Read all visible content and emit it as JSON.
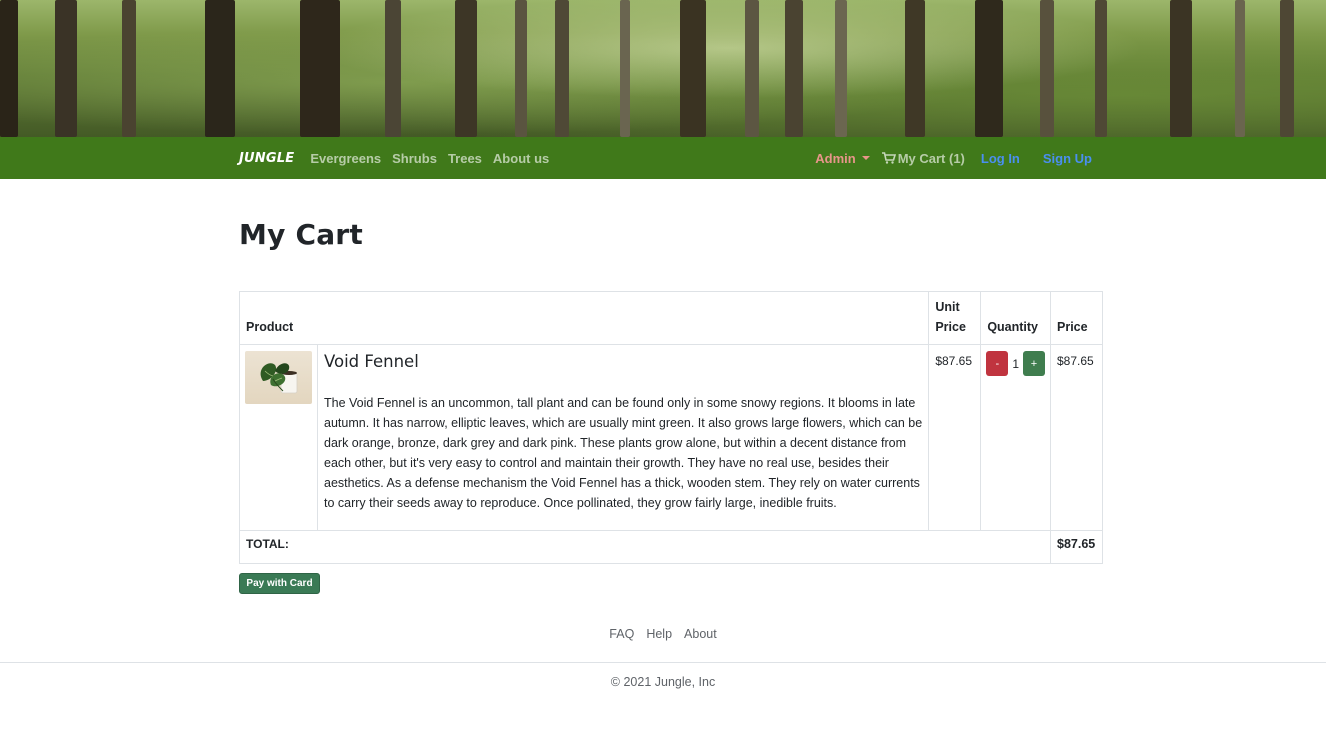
{
  "navbar": {
    "brand": "JUNGLE",
    "links": [
      "Evergreens",
      "Shrubs",
      "Trees",
      "About us"
    ],
    "admin_label": "Admin",
    "cart_label": "My Cart (1)",
    "login_label": "Log In",
    "signup_label": "Sign Up",
    "colors": {
      "bar": "#40791a",
      "admin": "#e8968a",
      "auth": "#4a8ff0"
    }
  },
  "page": {
    "title": "My Cart"
  },
  "cart": {
    "headers": {
      "product": "Product",
      "unit_price": "Unit Price",
      "quantity": "Quantity",
      "price": "Price"
    },
    "items": [
      {
        "name": "Void Fennel",
        "description": "The Void Fennel is an uncommon, tall plant and can be found only in some snowy regions. It blooms in late autumn. It has narrow, elliptic leaves, which are usually mint green. It also grows large flowers, which can be dark orange, bronze, dark grey and dark pink. These plants grow alone, but within a decent distance from each other, but it's very easy to control and maintain their growth. They have no real use, besides their aesthetics. As a defense mechanism the Void Fennel has a thick, wooden stem. They rely on water currents to carry their seeds away to reproduce. Once pollinated, they grow fairly large, inedible fruits.",
        "unit_price": "$87.65",
        "quantity": "1",
        "price": "$87.65",
        "decrement_label": "-",
        "increment_label": "+"
      }
    ],
    "total_label": "TOTAL:",
    "total_value": "$87.65"
  },
  "pay_button_label": "Pay with Card",
  "footer": {
    "links": [
      "FAQ",
      "Help",
      "About"
    ],
    "copyright": "© 2021 Jungle, Inc"
  }
}
